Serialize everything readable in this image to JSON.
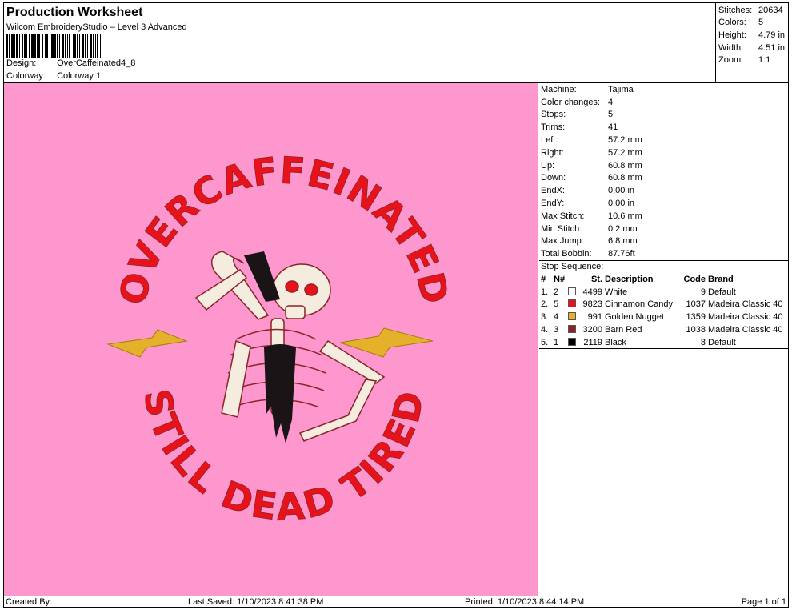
{
  "header": {
    "title": "Production Worksheet",
    "subtitle": "Wilcom EmbroideryStudio – Level 3 Advanced",
    "design_label": "Design:",
    "design_value": "OverCaffeinated4_8",
    "colorway_label": "Colorway:",
    "colorway_value": "Colorway 1"
  },
  "stats": [
    {
      "label": "Stitches:",
      "value": "20634"
    },
    {
      "label": "Colors:",
      "value": "5"
    },
    {
      "label": "Height:",
      "value": "4.79 in"
    },
    {
      "label": "Width:",
      "value": "4.51 in"
    },
    {
      "label": "Zoom:",
      "value": "1:1"
    }
  ],
  "properties": [
    {
      "label": "Machine:",
      "value": "Tajima"
    },
    {
      "label": "Color changes:",
      "value": "4"
    },
    {
      "label": "Stops:",
      "value": "5"
    },
    {
      "label": "Trims:",
      "value": "41"
    },
    {
      "label": "Left:",
      "value": "57.2 mm"
    },
    {
      "label": "Right:",
      "value": "57.2 mm"
    },
    {
      "label": "Up:",
      "value": "60.8 mm"
    },
    {
      "label": "Down:",
      "value": "60.8 mm"
    },
    {
      "label": "EndX:",
      "value": "0.00 in"
    },
    {
      "label": "EndY:",
      "value": "0.00 in"
    },
    {
      "label": "Max Stitch:",
      "value": "10.6 mm"
    },
    {
      "label": "Min Stitch:",
      "value": "0.2 mm"
    },
    {
      "label": "Max Jump:",
      "value": "6.8 mm"
    },
    {
      "label": "Total Bobbin:",
      "value": "87.76ft"
    }
  ],
  "stop_sequence": {
    "caption": "Stop Sequence:",
    "headers": {
      "num": "#",
      "n": "N#",
      "st": "St.",
      "description": "Description",
      "code": "Code",
      "brand": "Brand"
    },
    "rows": [
      {
        "num": "1.",
        "n": "2",
        "color": "#ffffff",
        "st": "4499",
        "description": "White",
        "code": "9",
        "brand": "Default"
      },
      {
        "num": "2.",
        "n": "5",
        "color": "#e8131a",
        "st": "9823",
        "description": "Cinnamon Candy",
        "code": "1037",
        "brand": "Madeira Classic 40"
      },
      {
        "num": "3.",
        "n": "4",
        "color": "#e5b12a",
        "st": "991",
        "description": "Golden Nugget",
        "code": "1359",
        "brand": "Madeira Classic 40"
      },
      {
        "num": "4.",
        "n": "3",
        "color": "#8c2325",
        "st": "3200",
        "description": "Barn Red",
        "code": "1038",
        "brand": "Madeira Classic 40"
      },
      {
        "num": "5.",
        "n": "1",
        "color": "#000000",
        "st": "2119",
        "description": "Black",
        "code": "8",
        "brand": "Default"
      }
    ]
  },
  "design_image": {
    "background": "#fd97cd",
    "top_text": "OVERCAFFEINATED",
    "bottom_text": "STILL DEAD TIRED",
    "text_color": "#e8131a",
    "bolt_color": "#e5b12a",
    "bone_color": "#f3ecdf",
    "outline_color": "#8c2325"
  },
  "footer": {
    "created_by": "Created By:",
    "last_saved": "Last Saved: 1/10/2023 8:41:38 PM",
    "printed": "Printed: 1/10/2023 8:44:14 PM",
    "page": "Page 1 of 1"
  }
}
